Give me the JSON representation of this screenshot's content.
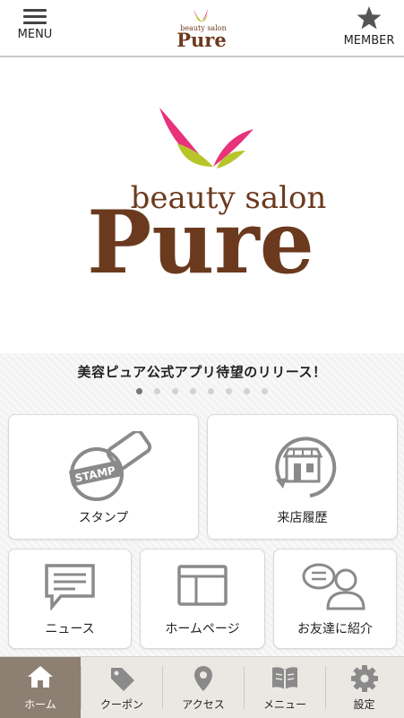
{
  "header": {
    "menu_label": "MENU",
    "member_label": "MEMBER",
    "logo_small": {
      "tagline": "beauty salon",
      "name": "Pure"
    }
  },
  "hero": {
    "tagline": "beauty salon",
    "name": "Pure"
  },
  "banner": {
    "caption": "美容ピュア公式アプリ待望のリリース！",
    "page_count": 8,
    "active_index": 0
  },
  "tiles": {
    "stamp": {
      "label": "スタンプ",
      "icon": "stamp-icon",
      "icon_text": "STAMP"
    },
    "history": {
      "label": "来店履歴",
      "icon": "shop-history-icon"
    },
    "news": {
      "label": "ニュース",
      "icon": "news-icon"
    },
    "homepage": {
      "label": "ホームページ",
      "icon": "browser-icon"
    },
    "refer": {
      "label": "お友達に紹介",
      "icon": "refer-friend-icon"
    }
  },
  "tabs": [
    {
      "label": "ホーム",
      "icon": "home-icon",
      "active": true
    },
    {
      "label": "クーポン",
      "icon": "tag-icon",
      "active": false
    },
    {
      "label": "アクセス",
      "icon": "map-pin-icon",
      "active": false
    },
    {
      "label": "メニュー",
      "icon": "book-icon",
      "active": false
    },
    {
      "label": "設定",
      "icon": "gear-icon",
      "active": false
    }
  ],
  "colors": {
    "brand_brown": "#6b3a1e",
    "leaf_pink": "#e8327c",
    "leaf_green": "#b7c52a",
    "tab_active": "#8e7f73",
    "icon_gray": "#8a8a8a"
  }
}
